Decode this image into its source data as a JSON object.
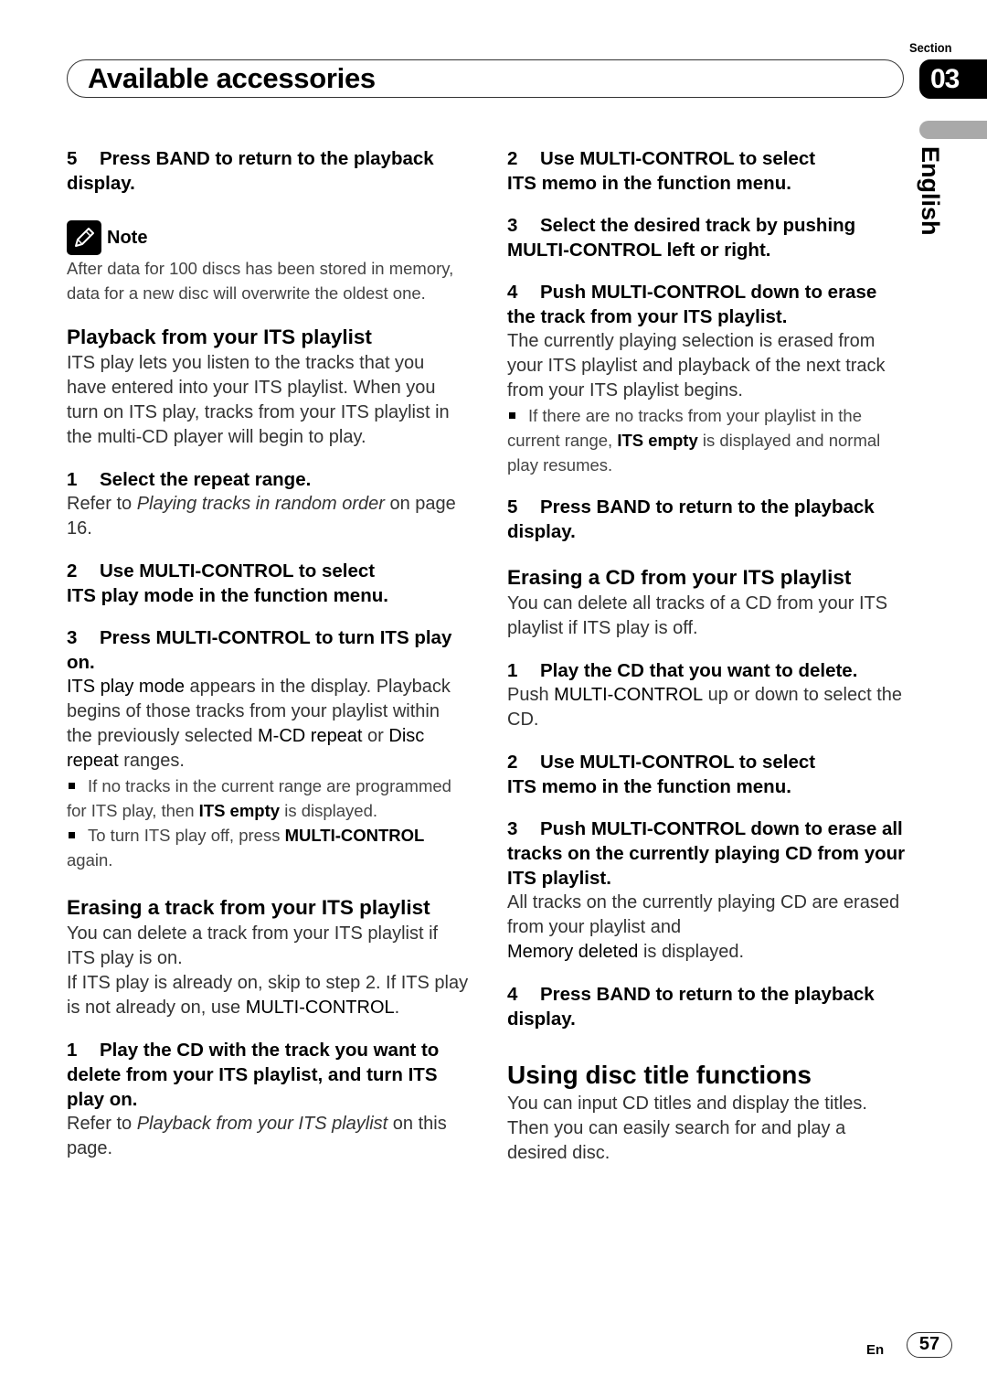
{
  "header": {
    "title": "Available accessories",
    "section_label": "Section",
    "section_number": "03",
    "language": "English"
  },
  "left": {
    "step5": {
      "num": "5",
      "text": "Press BAND to return to the playback display."
    },
    "note": {
      "label": "Note",
      "icon": "pencil-icon",
      "text": "After data for 100 discs has been stored in memory, data for a new disc will overwrite the oldest one."
    },
    "playback": {
      "heading": "Playback from your ITS playlist",
      "intro": "ITS play lets you listen to the tracks that you have entered into your ITS playlist. When you turn on ITS play, tracks from your ITS playlist in the multi-CD player will begin to play.",
      "step1": {
        "num": "1",
        "text": "Select the repeat range."
      },
      "step1_body_pre": "Refer to ",
      "step1_body_italic": "Playing tracks in random order",
      "step1_body_post": " on page 16.",
      "step2": {
        "num": "2",
        "text_line1": "Use MULTI-CONTROL to select",
        "text_line2": "ITS play mode in the function menu."
      },
      "step3": {
        "num": "3",
        "text": "Press MULTI-CONTROL to turn ITS play on."
      },
      "step3_body": {
        "b1": "ITS play mode",
        "t1": " appears in the display. Playback begins of those tracks from your playlist within the previously selected ",
        "b2": "M-CD repeat",
        "t2": " or ",
        "b3": "Disc repeat",
        "t3": " ranges."
      },
      "bullets": [
        {
          "pre": "If no tracks in the current range are programmed for ITS play, then ",
          "bold": "ITS empty",
          "post": " is displayed."
        },
        {
          "pre": "To turn ITS play off, press ",
          "bold": "MULTI-CONTROL",
          "post": " again."
        }
      ]
    },
    "erase_track": {
      "heading": "Erasing a track from your ITS playlist",
      "intro1": "You can delete a track from your ITS playlist if ITS play is on.",
      "intro2_pre": "If ITS play is already on, skip to step 2. If ITS play is not already on, use ",
      "intro2_bold": "MULTI-CONTROL",
      "intro2_post": ".",
      "step1": {
        "num": "1",
        "text": "Play the CD with the track you want to delete from your ITS playlist, and turn ITS play on."
      },
      "step1_body_pre": "Refer to ",
      "step1_body_italic": "Playback from your ITS playlist",
      "step1_body_post": " on this page."
    }
  },
  "right": {
    "step2": {
      "num": "2",
      "text_line1": "Use MULTI-CONTROL to select",
      "text_line2": "ITS memo in the function menu."
    },
    "step3": {
      "num": "3",
      "text": "Select the desired track by pushing MULTI-CONTROL left or right."
    },
    "step4": {
      "num": "4",
      "text": "Push MULTI-CONTROL down to erase the track from your ITS playlist."
    },
    "step4_body": "The currently playing selection is erased from your ITS playlist and playback of the next track from your ITS playlist begins.",
    "step4_bullet": {
      "pre": "If there are no tracks from your playlist in the current range, ",
      "bold": "ITS empty",
      "post": " is displayed and normal play resumes."
    },
    "step5": {
      "num": "5",
      "text": "Press BAND to return to the playback display."
    },
    "erase_cd": {
      "heading": "Erasing a CD from your ITS playlist",
      "intro": "You can delete all tracks of a CD from your ITS playlist if ITS play is off.",
      "step1": {
        "num": "1",
        "text": "Play the CD that you want to delete."
      },
      "step1_body": {
        "pre": "Push ",
        "bold": "MULTI-CONTROL",
        "post": " up or down to select the CD."
      },
      "step2": {
        "num": "2",
        "text_line1": "Use MULTI-CONTROL to select",
        "text_line2": "ITS memo in the function menu."
      },
      "step3": {
        "num": "3",
        "text": "Push MULTI-CONTROL down to erase all tracks on the currently playing CD from your ITS playlist."
      },
      "step3_body": {
        "pre": "All tracks on the currently playing CD are erased from your playlist and",
        "bold": "Memory deleted",
        "post": " is displayed."
      },
      "step4": {
        "num": "4",
        "text": "Press BAND to return to the playback display."
      }
    },
    "disc_title": {
      "heading": "Using disc title functions",
      "intro": "You can input CD titles and display the titles. Then you can easily search for and play a desired disc."
    }
  },
  "footer": {
    "lang": "En",
    "page": "57"
  }
}
